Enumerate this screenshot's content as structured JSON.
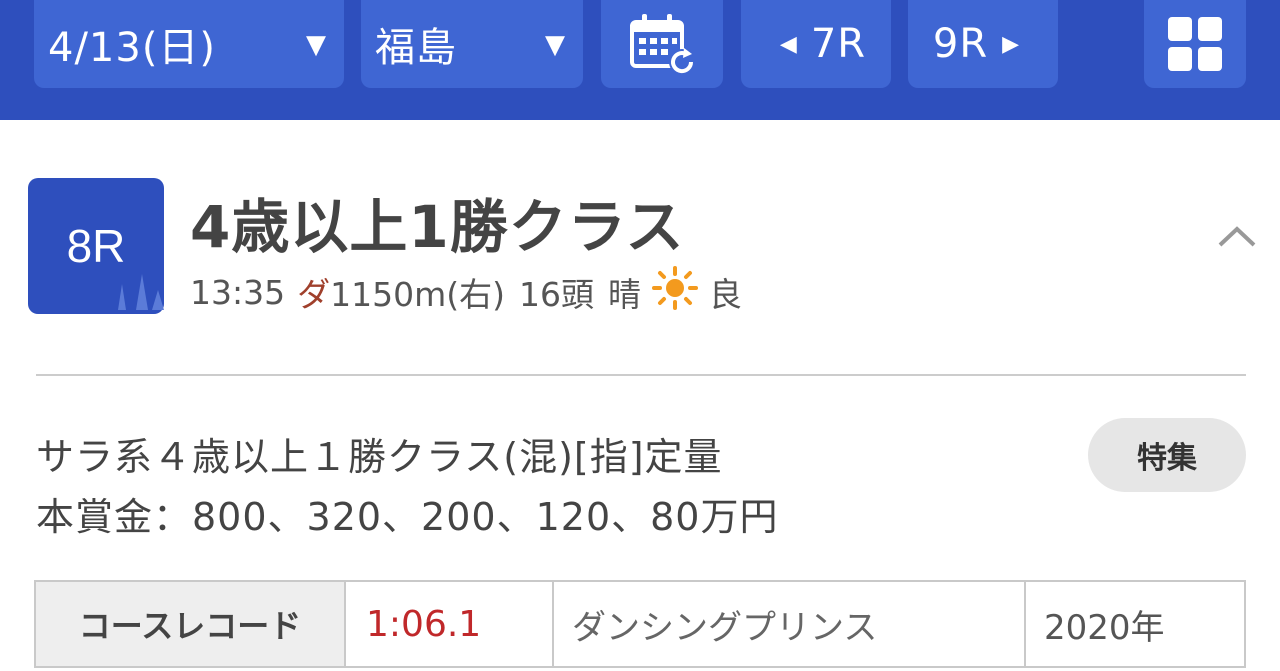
{
  "nav": {
    "date": "4/13(日)",
    "venue": "福島",
    "prev_race": "7R",
    "next_race": "9R"
  },
  "race": {
    "number": "8R",
    "title": "4歳以上1勝クラス",
    "time": "13:35",
    "surface": "ダ",
    "distance": "1150m(右)",
    "runners": "16頭",
    "weather": "晴",
    "weather_icon": "sun-icon",
    "track_condition": "良"
  },
  "conditions": {
    "line1": "サラ系４歳以上１勝クラス(混)[指]定量",
    "line2": "本賞金：800、320、200、120、80万円",
    "feature_button": "特集"
  },
  "record": {
    "label": "コースレコード",
    "time": "1:06.1",
    "horse": "ダンシングプリンス",
    "year": "2020年"
  },
  "colors": {
    "nav_bg": "#2e4fbd",
    "nav_button": "#3f66d3",
    "record_time": "#c0282a",
    "surface_text": "#a0402c",
    "sun": "#f39a1e"
  }
}
